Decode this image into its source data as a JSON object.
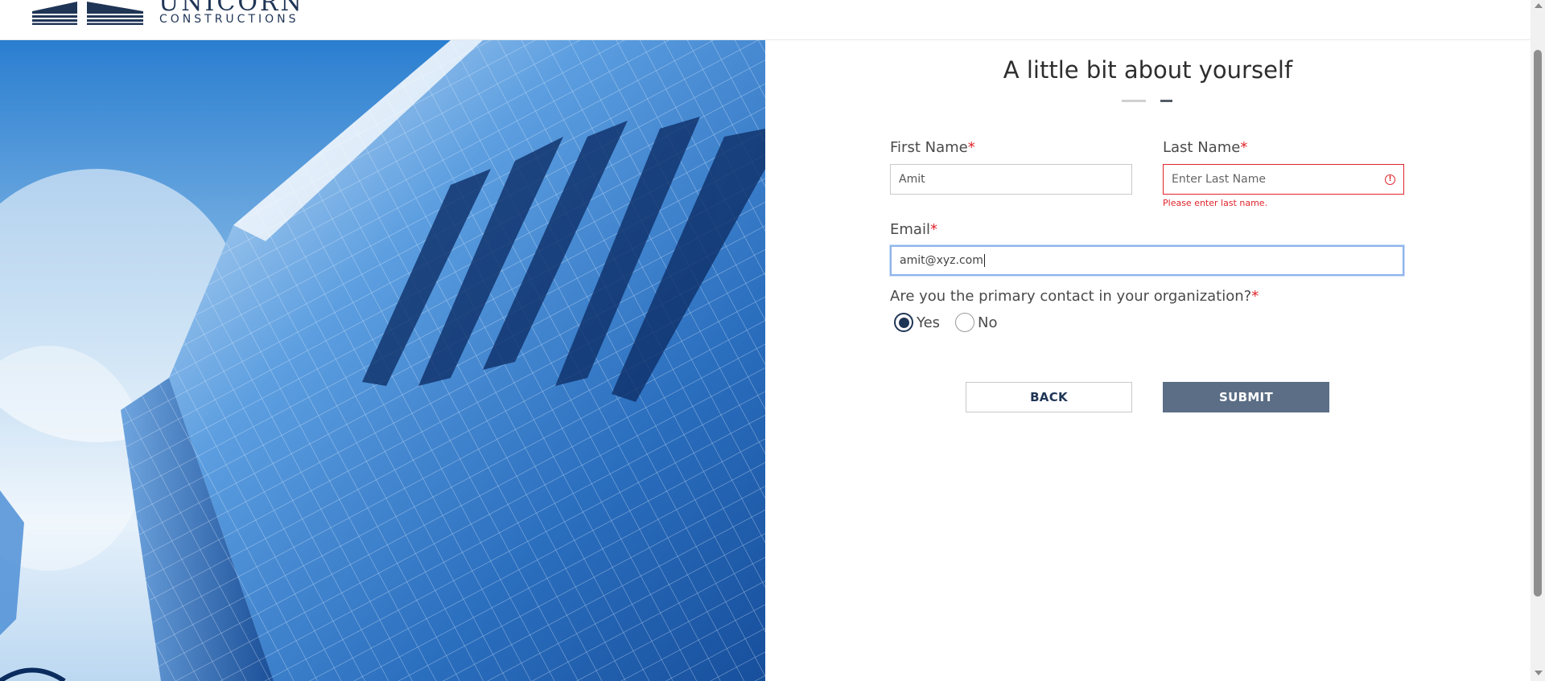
{
  "brand": {
    "name": "UNICORN",
    "tagline": "CONSTRUCTIONS"
  },
  "form": {
    "title": "A little bit about yourself",
    "first_name": {
      "label": "First Name",
      "required_mark": "*",
      "value": "Amit"
    },
    "last_name": {
      "label": "Last Name",
      "required_mark": "*",
      "placeholder": "Enter Last Name",
      "error": "Please enter last name.",
      "error_icon": "!"
    },
    "email": {
      "label": "Email",
      "required_mark": "*",
      "value": "amit@xyz.com"
    },
    "primary_contact": {
      "question": "Are you the primary contact in your organization?",
      "required_mark": "*",
      "options": [
        "Yes",
        "No"
      ],
      "selected": "Yes"
    },
    "back_label": "BACK",
    "submit_label": "SUBMIT"
  },
  "colors": {
    "accent": "#1f3556",
    "error": "#e0242c",
    "submit_bg": "#5b6e86"
  }
}
